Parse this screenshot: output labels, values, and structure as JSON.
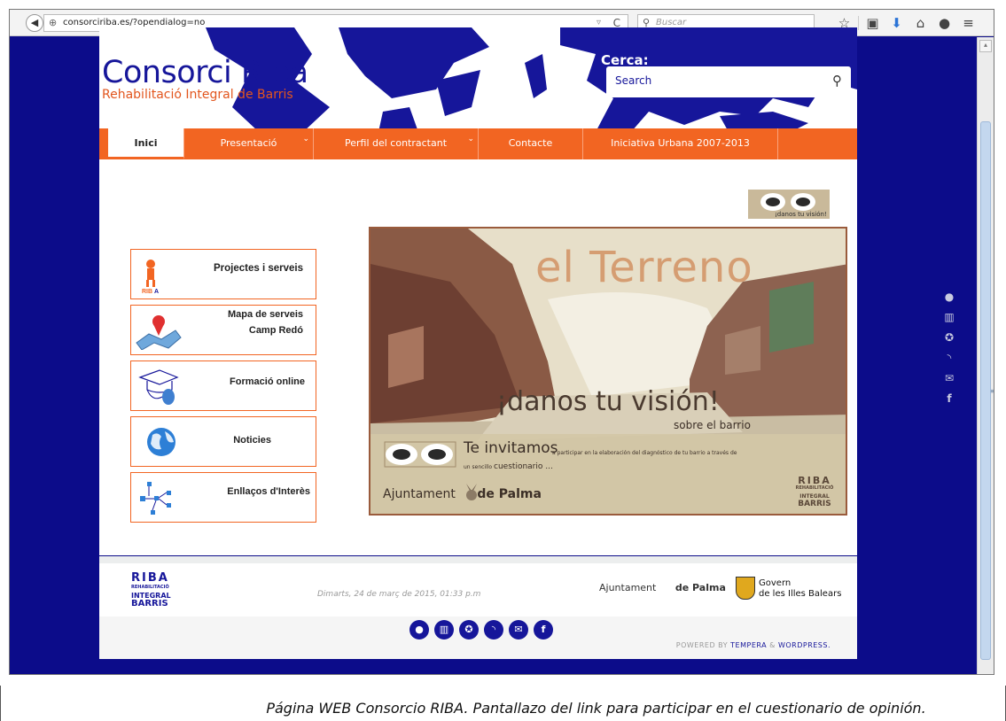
{
  "browser": {
    "url": "consorciriba.es/?opendialog=no",
    "search_placeholder": "Buscar",
    "toolbar_icons": [
      "star-icon",
      "clipboard-icon",
      "download-icon",
      "home-icon",
      "chat-icon",
      "menu-icon"
    ]
  },
  "header": {
    "title": "Consorci Riba",
    "subtitle": "Rehabilitació Integral de Barris",
    "search_label": "Cerca:",
    "search_placeholder": "Search"
  },
  "nav": {
    "items": [
      {
        "label": "Inici",
        "active": true
      },
      {
        "label": "Presentació",
        "dropdown": true
      },
      {
        "label": "Perfil del contractant",
        "dropdown": true
      },
      {
        "label": "Contacte"
      },
      {
        "label": "Iniciativa Urbana 2007-2013"
      }
    ]
  },
  "sidebar": {
    "items": [
      {
        "label": "Projectes i serveis",
        "icon": "riba-person-icon"
      },
      {
        "label_line1": "Mapa de serveis",
        "label_line2": "Camp Redó",
        "icon": "map-pin-icon"
      },
      {
        "label": "Formació online",
        "icon": "graduation-mouse-icon"
      },
      {
        "label": "Noticies",
        "icon": "globe-icon"
      },
      {
        "label": "Enllaços d'Interès",
        "icon": "network-icon"
      }
    ]
  },
  "banner": {
    "title": "el Terreno",
    "headline": "¡danos tu visión!",
    "subheadline": "sobre el barrio",
    "invite_big": "Te invitamos",
    "invite_small": "a participar en la elaboración del diagnóstico de tu barrio a través de",
    "invite_line2_small": "un sencillo",
    "invite_line2_q": "cuestionario ...",
    "ajuntament": "Ajuntament",
    "de_palma": "de Palma",
    "riba_lines": [
      "RIBA",
      "REHABILITACIÓ",
      "INTEGRAL",
      "BARRIS"
    ]
  },
  "thumb_caption": "¡danos tu visión!",
  "side_social_icons": [
    "lock-icon",
    "youtube-icon",
    "circle-icon",
    "rss-icon",
    "mail-icon",
    "facebook-icon"
  ],
  "footer": {
    "riba_lines": [
      "RIBA",
      "REHABILITACIÓ",
      "INTEGRAL",
      "BARRIS"
    ],
    "date": "Dimarts, 24 de març de 2015, 01:33 p.m",
    "ajuntament": "Ajuntament",
    "de_palma": "de Palma",
    "govern_line1": "Govern",
    "govern_line2": "de les Illes Balears",
    "social_icons": [
      "lock-icon",
      "youtube-icon",
      "circle-icon",
      "rss-icon",
      "mail-icon",
      "facebook-icon"
    ],
    "powered_prefix": "POWERED BY",
    "powered_tempera": "TEMPERA",
    "powered_amp": "&",
    "powered_wp": "WORDPRESS."
  },
  "caption": "Página WEB Consorcio RIBA. Pantallazo del link para participar en el cuestionario de opinión.",
  "colors": {
    "background": "#0c0c8a",
    "brand_blue": "#16169a",
    "brand_orange": "#f26522"
  }
}
